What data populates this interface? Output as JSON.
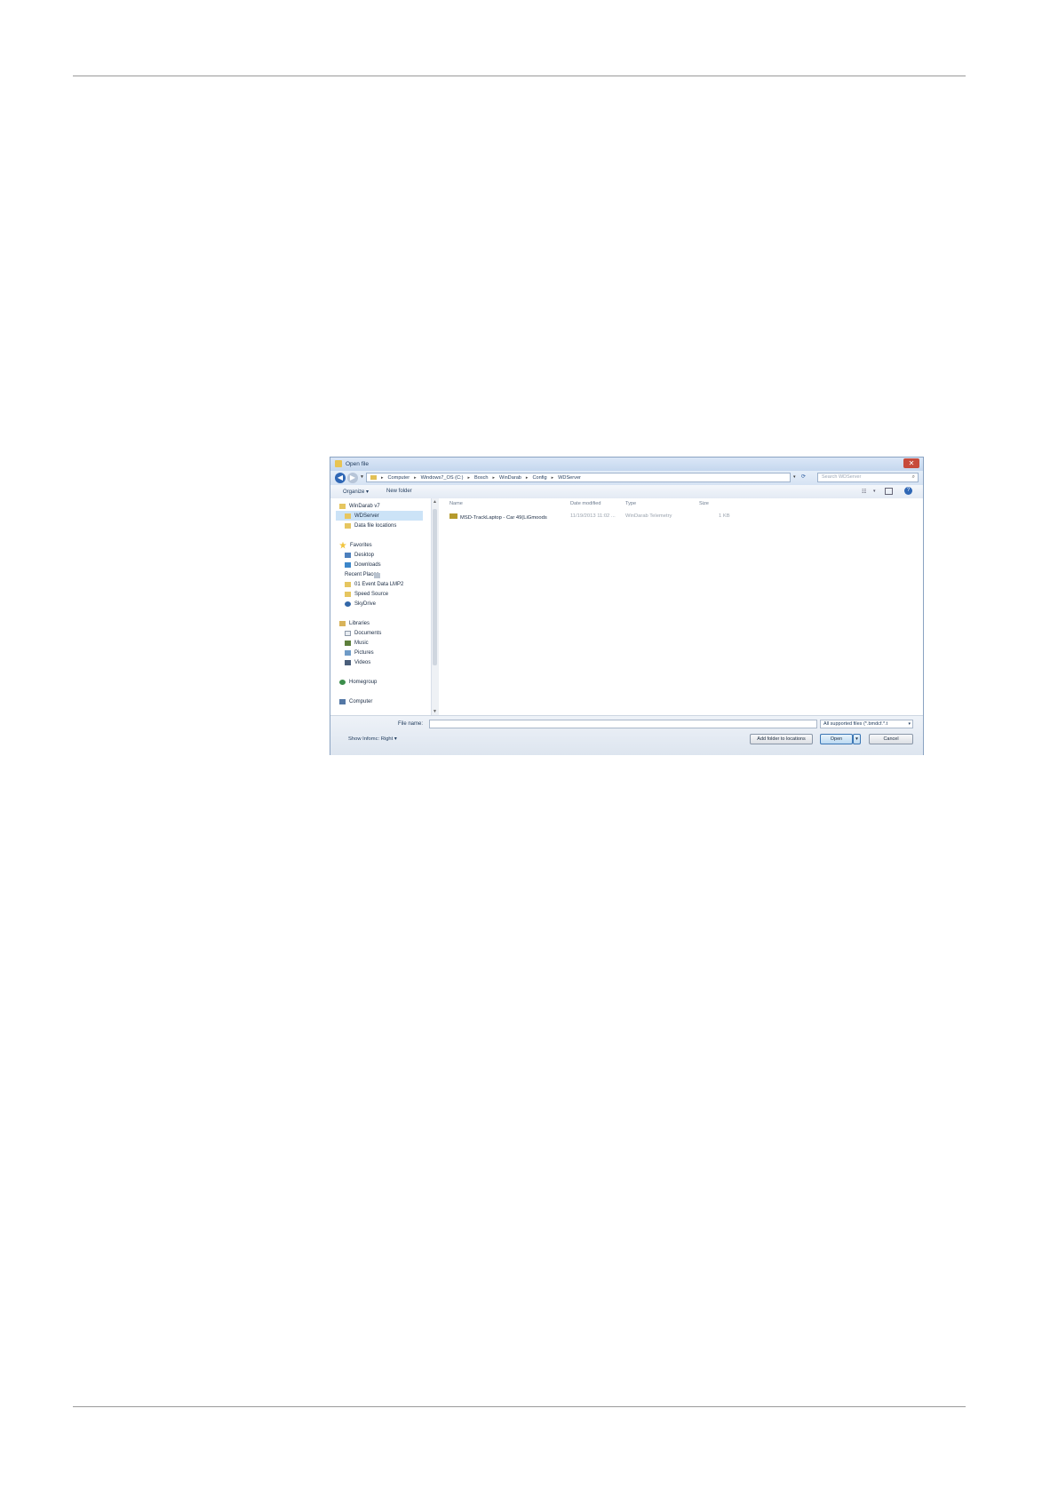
{
  "dialog": {
    "title": "Open file",
    "close_label": "✕",
    "breadcrumb": [
      "Computer",
      "Windows7_OS (C:)",
      "Bosch",
      "WinDarab",
      "Config",
      "WDServer"
    ],
    "search_placeholder": "Search WDServer",
    "toolbar": {
      "organize": "Organize ▾",
      "new_folder": "New folder"
    },
    "nav": {
      "root": "WinDarab v7",
      "root_children": [
        "WDServer",
        "Data file locations"
      ],
      "favorites_header": "Favorites",
      "favorites": [
        "Desktop",
        "Downloads",
        "Recent Places",
        "01 Event Data LMP2",
        "Speed Source",
        "SkyDrive"
      ],
      "libraries_header": "Libraries",
      "libraries": [
        "Documents",
        "Music",
        "Pictures",
        "Videos"
      ],
      "homegroup": "Homegroup",
      "computer": "Computer"
    },
    "columns": {
      "name": "Name",
      "date": "Date modified",
      "type": "Type",
      "size": "Size"
    },
    "files": [
      {
        "name": "MSD-TrackLaptop - Car 49(LiGmoods",
        "date": "11/19/2013 11:02 ...",
        "type": "WinDarab Telemetry",
        "size": "1 KB"
      }
    ],
    "footer": {
      "file_name_label": "File name:",
      "file_name_value": "",
      "filter": "All supported files (*.bmdcf.*.t",
      "show_infomc": "Show Infomc: Right ▾",
      "add_folder_button": "Add folder to locations",
      "open_button": "Open",
      "cancel_button": "Cancel"
    }
  }
}
